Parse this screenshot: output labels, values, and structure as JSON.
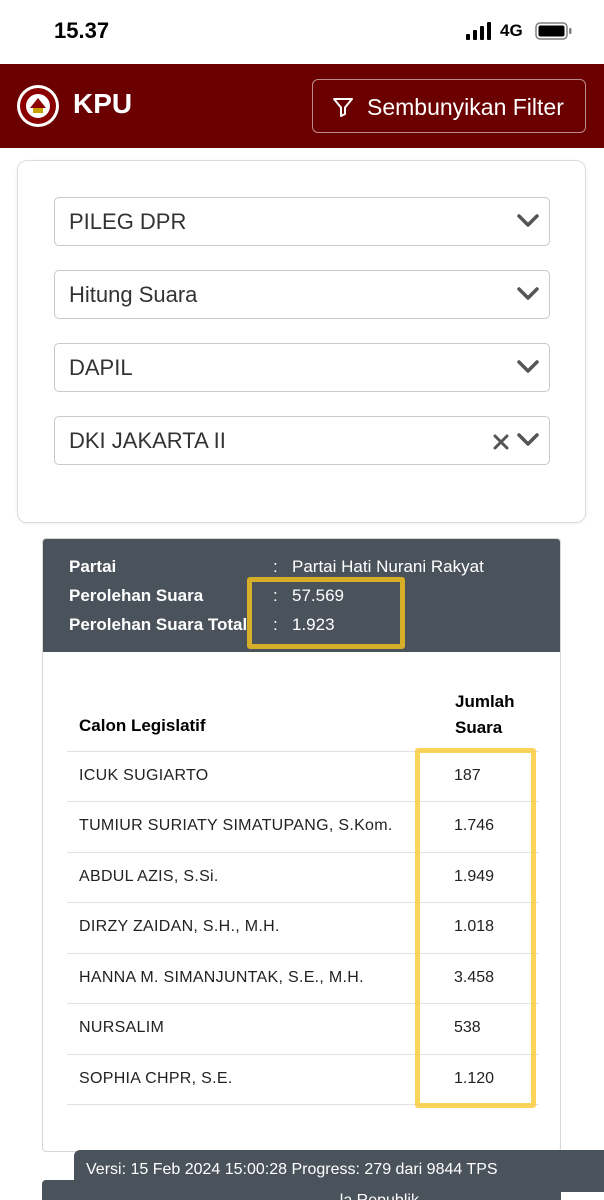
{
  "status_bar": {
    "time": "15.37",
    "network": "4G"
  },
  "header": {
    "brand": "KPU",
    "filter_button_label": "Sembunyikan Filter",
    "background_color": "#6a0000"
  },
  "filters": [
    {
      "value": "PILEG DPR"
    },
    {
      "value": "Hitung Suara"
    },
    {
      "value": "DAPIL"
    },
    {
      "value": "DKI JAKARTA II"
    }
  ],
  "party_info": {
    "party_label": "Partai",
    "party_value": "Partai Hati Nurani Rakyat",
    "votes_label": "Perolehan Suara",
    "votes_value": "57.569",
    "total_label": "Perolehan Suara Total",
    "total_value": "1.923",
    "separator": ":"
  },
  "table": {
    "col_name": "Calon Legislatif",
    "col_votes_line1": "Jumlah",
    "col_votes_line2": "Suara",
    "rows": [
      {
        "name": "ICUK SUGIARTO",
        "votes": "187"
      },
      {
        "name": "TUMIUR SURIATY SIMATUPANG, S.Kom.",
        "votes": "1.746"
      },
      {
        "name": "ABDUL AZIS, S.Si.",
        "votes": "1.949"
      },
      {
        "name": "DIRZY ZAIDAN, S.H., M.H.",
        "votes": "1.018"
      },
      {
        "name": "HANNA M. SIMANJUNTAK, S.E., M.H.",
        "votes": "3.458"
      },
      {
        "name": "NURSALIM",
        "votes": "538"
      },
      {
        "name": "SOPHIA CHPR, S.E.",
        "votes": "1.120"
      }
    ]
  },
  "version_banner": "Versi: 15 Feb 2024 15:00:28 Progress: 279 dari 9844 TPS",
  "next_card_text": "... la Republik"
}
